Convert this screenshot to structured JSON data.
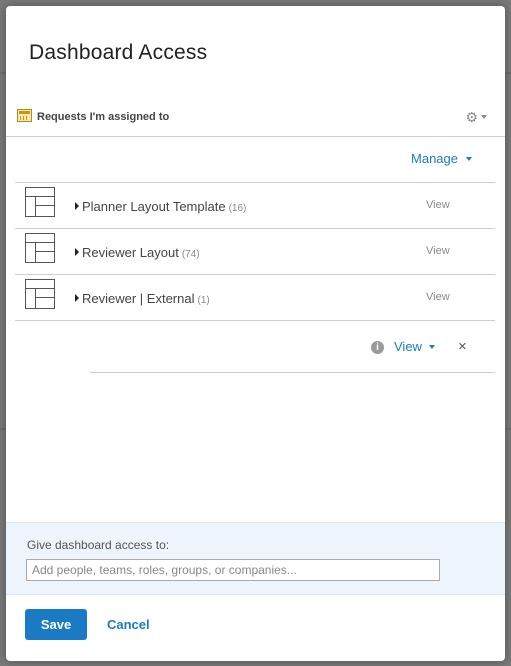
{
  "dialog": {
    "title": "Dashboard Access"
  },
  "panel": {
    "title": "Requests I'm assigned to",
    "settings_icon": "gear-icon"
  },
  "manage_label": "Manage",
  "layouts": [
    {
      "name": "Planner Layout Template",
      "count": "(16)",
      "action": "View"
    },
    {
      "name": "Reviewer Layout",
      "count": "(74)",
      "action": "View"
    },
    {
      "name": "Reviewer | External",
      "count": "(1)",
      "action": "View"
    }
  ],
  "new_entry": {
    "permission": "View",
    "info_icon": "info-icon",
    "remove_icon": "close-icon"
  },
  "grant": {
    "label": "Give dashboard access to:",
    "placeholder": "Add people, teams, roles, groups, or companies..."
  },
  "footer": {
    "save_label": "Save",
    "cancel_label": "Cancel"
  },
  "colors": {
    "accent": "#1a7bc4",
    "grant_bg": "#eef4fb",
    "backdrop": "#7a7a7a"
  }
}
